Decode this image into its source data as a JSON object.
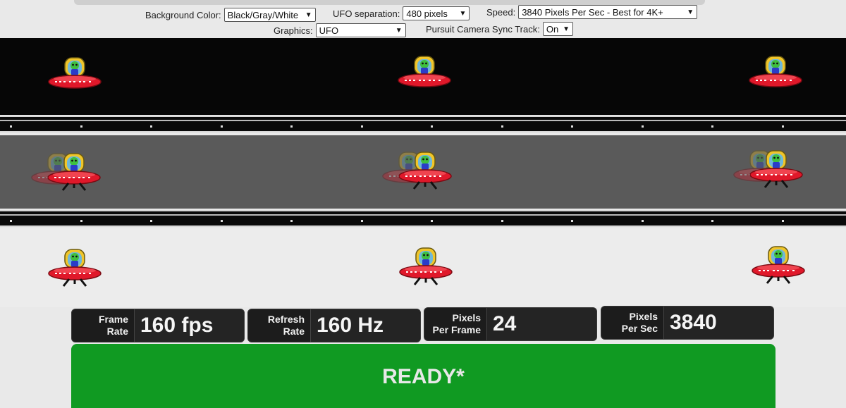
{
  "controls": {
    "background_color": {
      "label": "Background Color:",
      "value": "Black/Gray/White"
    },
    "ufo_separation": {
      "label": "UFO separation:",
      "value": "480 pixels"
    },
    "speed": {
      "label": "Speed:",
      "value": "3840 Pixels Per Sec - Best for 4K+"
    },
    "graphics": {
      "label": "Graphics:",
      "value": "UFO"
    },
    "pursuit_camera": {
      "label": "Pursuit Camera Sync Track:",
      "value": "On"
    }
  },
  "icons": {
    "ufo": "ufo-alien-icon",
    "chevron": "chevron-down-icon"
  },
  "stats": {
    "frame_rate": {
      "label1": "Frame",
      "label2": "Rate",
      "value": "160 fps"
    },
    "refresh_rate": {
      "label1": "Refresh",
      "label2": "Rate",
      "value": "160 Hz"
    },
    "pixels_per_frame": {
      "label1": "Pixels",
      "label2": "Per Frame",
      "value": "24"
    },
    "pixels_per_sec": {
      "label1": "Pixels",
      "label2": "Per Sec",
      "value": "3840"
    }
  },
  "status": {
    "text": "READY*"
  },
  "colors": {
    "ready_green": "#109a22",
    "ufo_red": "#e0182a",
    "alien_green": "#3fbf3f"
  }
}
